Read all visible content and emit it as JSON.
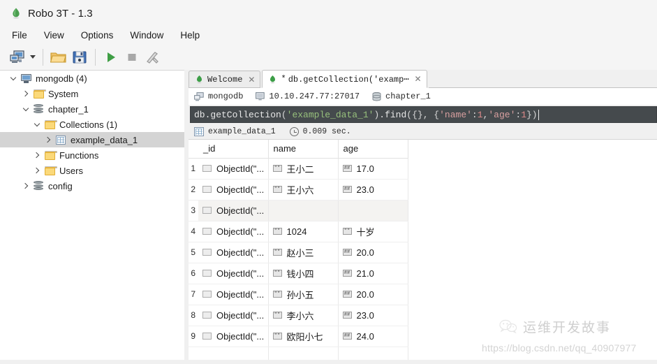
{
  "window": {
    "title": "Robo 3T - 1.3",
    "app_icon": "leaf-icon"
  },
  "menubar": {
    "items": [
      {
        "label": "File"
      },
      {
        "label": "View"
      },
      {
        "label": "Options"
      },
      {
        "label": "Window"
      },
      {
        "label": "Help"
      }
    ]
  },
  "toolbar": {
    "buttons": [
      {
        "name": "connect-button",
        "icon": "computer-icon",
        "label": "Connect"
      },
      {
        "name": "connect-dropdown",
        "icon": "chevron-down-icon",
        "label": ""
      },
      {
        "name": "open-script-button",
        "icon": "folder-open-icon",
        "label": "Open Script"
      },
      {
        "name": "save-script-button",
        "icon": "floppy-disk-icon",
        "label": "Save Script"
      },
      {
        "name": "execute-button",
        "icon": "play-icon",
        "label": "Execute"
      },
      {
        "name": "stop-button",
        "icon": "stop-square-icon",
        "label": "Stop"
      },
      {
        "name": "refresh-button",
        "icon": "wrench-icon",
        "label": "Refresh"
      }
    ]
  },
  "tree": {
    "nodes": [
      {
        "label": "mongodb (4)",
        "icon": "computer-icon",
        "indent": 0,
        "twisty": "down",
        "selected": false
      },
      {
        "label": "System",
        "icon": "folder-icon",
        "indent": 1,
        "twisty": "right",
        "selected": false
      },
      {
        "label": "chapter_1",
        "icon": "database-icon",
        "indent": 1,
        "twisty": "down",
        "selected": false
      },
      {
        "label": "Collections (1)",
        "icon": "folder-icon",
        "indent": 2,
        "twisty": "down",
        "selected": false
      },
      {
        "label": "example_data_1",
        "icon": "grid-icon",
        "indent": 3,
        "twisty": "right",
        "selected": true
      },
      {
        "label": "Functions",
        "icon": "folder-icon",
        "indent": 2,
        "twisty": "right",
        "selected": false
      },
      {
        "label": "Users",
        "icon": "folder-icon",
        "indent": 2,
        "twisty": "right",
        "selected": false
      },
      {
        "label": "config",
        "icon": "database-icon",
        "indent": 1,
        "twisty": "right",
        "selected": false
      }
    ]
  },
  "tabs": [
    {
      "label": "Welcome",
      "icon": "leaf-icon",
      "modified": "",
      "active": false,
      "close": "✕"
    },
    {
      "label": "db.getCollection('examp⋯",
      "icon": "leaf-icon",
      "modified": "*",
      "active": true,
      "close": "✕"
    }
  ],
  "connection_bar": {
    "server_name": "mongodb",
    "server_icon": "computer-icon",
    "host": "10.10.247.77:27017",
    "host_icon": "monitor-icon",
    "database": "chapter_1",
    "database_icon": "database-icon"
  },
  "query": {
    "tokens": [
      {
        "text": "db.getCollection",
        "cls": "plain"
      },
      {
        "text": "(",
        "cls": "punct"
      },
      {
        "text": "'example_data_1'",
        "cls": "str"
      },
      {
        "text": ")",
        "cls": "punct"
      },
      {
        "text": ".find",
        "cls": "plain"
      },
      {
        "text": "({}, {",
        "cls": "punct"
      },
      {
        "text": "'name'",
        "cls": "key"
      },
      {
        "text": ": ",
        "cls": "punct"
      },
      {
        "text": "1",
        "cls": "num"
      },
      {
        "text": ", ",
        "cls": "punct"
      },
      {
        "text": "'age'",
        "cls": "key"
      },
      {
        "text": ": ",
        "cls": "punct"
      },
      {
        "text": "1",
        "cls": "num"
      },
      {
        "text": "})",
        "cls": "punct"
      }
    ],
    "full_text": "db.getCollection('example_data_1').find({}, {'name': 1, 'age': 1})"
  },
  "result_header": {
    "collection": "example_data_1",
    "collection_icon": "grid-icon",
    "time": "0.009 sec.",
    "clock_icon": "clock-icon"
  },
  "results": {
    "columns": [
      "_id",
      "name",
      "age"
    ],
    "rows": [
      {
        "n": "1",
        "id": "ObjectId(\"...",
        "id_type": "object",
        "name": "王小二",
        "name_type": "string",
        "age": "17.0",
        "age_type": "number",
        "alt": false
      },
      {
        "n": "2",
        "id": "ObjectId(\"...",
        "id_type": "object",
        "name": "王小六",
        "name_type": "string",
        "age": "23.0",
        "age_type": "number",
        "alt": false
      },
      {
        "n": "3",
        "id": "ObjectId(\"...",
        "id_type": "object",
        "name": "",
        "name_type": "",
        "age": "",
        "age_type": "",
        "alt": true
      },
      {
        "n": "4",
        "id": "ObjectId(\"...",
        "id_type": "object",
        "name": "1024",
        "name_type": "string",
        "age": "十岁",
        "age_type": "string",
        "alt": false
      },
      {
        "n": "5",
        "id": "ObjectId(\"...",
        "id_type": "object",
        "name": "赵小三",
        "name_type": "string",
        "age": "20.0",
        "age_type": "number",
        "alt": false
      },
      {
        "n": "6",
        "id": "ObjectId(\"...",
        "id_type": "object",
        "name": "钱小四",
        "name_type": "string",
        "age": "21.0",
        "age_type": "number",
        "alt": false
      },
      {
        "n": "7",
        "id": "ObjectId(\"...",
        "id_type": "object",
        "name": "孙小五",
        "name_type": "string",
        "age": "20.0",
        "age_type": "number",
        "alt": false
      },
      {
        "n": "8",
        "id": "ObjectId(\"...",
        "id_type": "object",
        "name": "李小六",
        "name_type": "string",
        "age": "23.0",
        "age_type": "number",
        "alt": false
      },
      {
        "n": "9",
        "id": "ObjectId(\"...",
        "id_type": "object",
        "name": "欧阳小七",
        "name_type": "string",
        "age": "24.0",
        "age_type": "number",
        "alt": false
      }
    ],
    "string_badge": "\"\"",
    "number_badge": "##"
  },
  "watermark": {
    "text": "运维开发故事",
    "icon": "wechat-icon",
    "url": "https://blog.csdn.net/qq_40907977"
  }
}
